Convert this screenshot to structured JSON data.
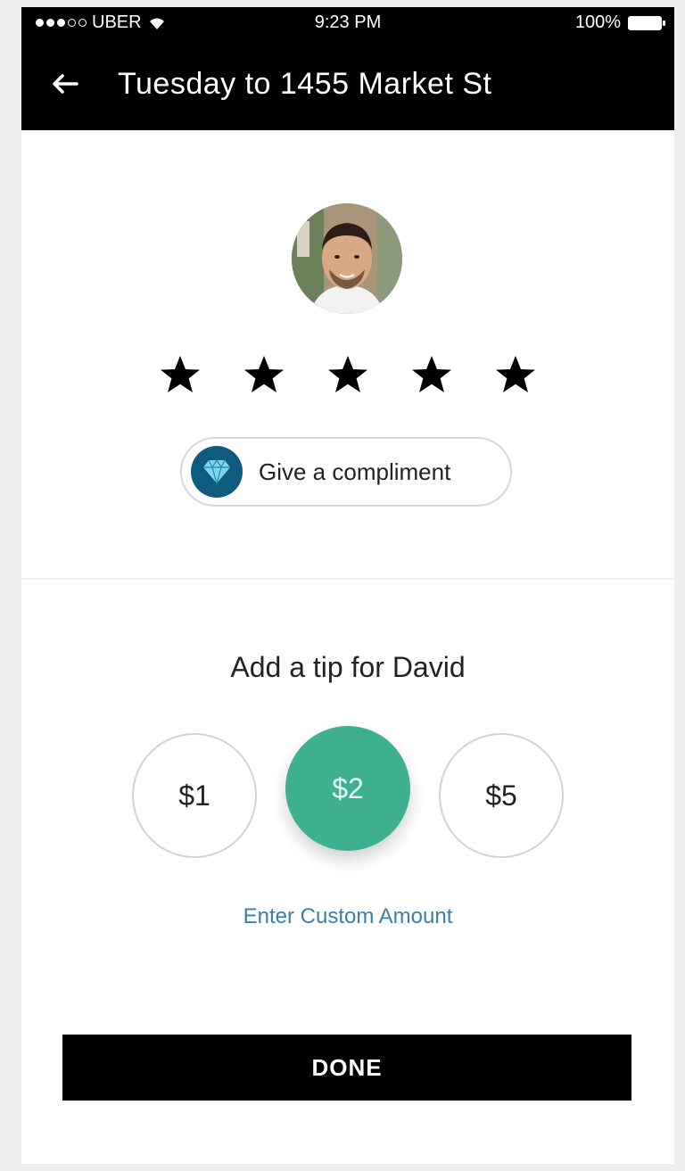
{
  "status_bar": {
    "carrier": "UBER",
    "time": "9:23 PM",
    "battery": "100%",
    "signal_bars": 3
  },
  "header": {
    "title": "Tuesday to 1455 Market St",
    "back_icon": "arrow-left-icon"
  },
  "rating": {
    "stars": 5,
    "compliment_label": "Give a compliment",
    "compliment_icon": "diamond-icon"
  },
  "tip": {
    "title": "Add a tip for David",
    "options": [
      "$1",
      "$2",
      "$5"
    ],
    "selected": "$2",
    "custom_label": "Enter Custom Amount",
    "accent_color": "#3fb08f",
    "link_color": "#3b7fa8"
  },
  "footer": {
    "done_label": "DONE"
  }
}
